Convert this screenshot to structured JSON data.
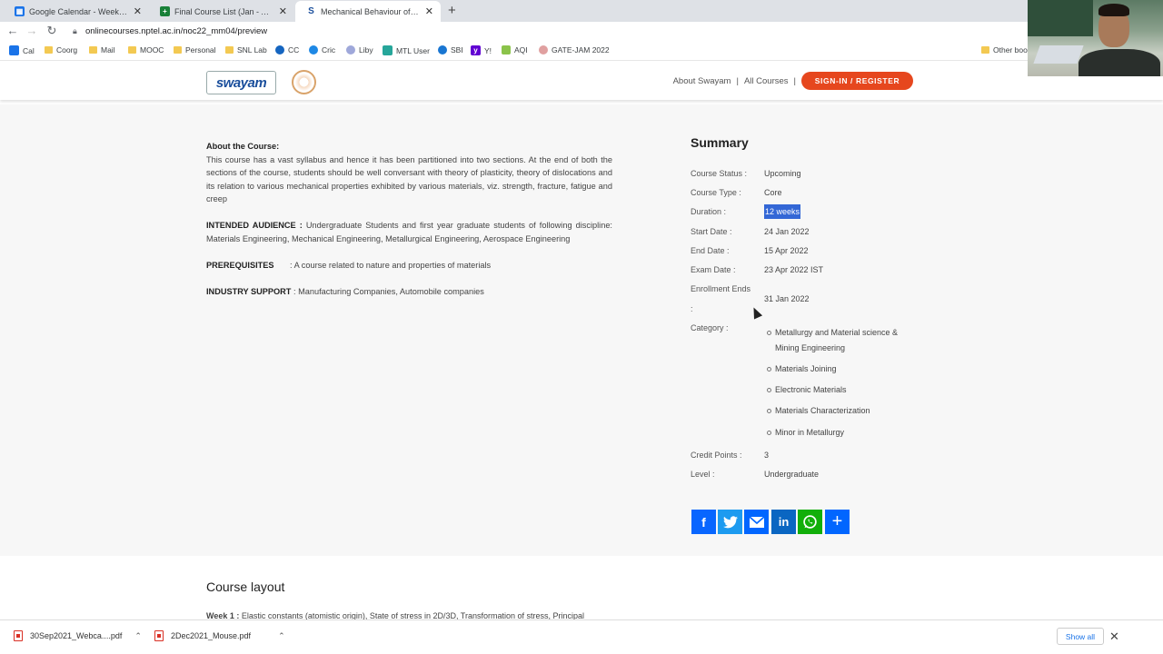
{
  "browser": {
    "tabs": [
      {
        "title": "Google Calendar - Week of Dece...",
        "favicon": "calendar-icon",
        "color": "#1a73e8"
      },
      {
        "title": "Final Course List (Jan - April 2022...",
        "favicon": "sheets-icon",
        "color": "#188038"
      },
      {
        "title": "Mechanical Behaviour of Materia...",
        "favicon": "swayam-icon",
        "color": "#1b4f9c"
      }
    ],
    "new_tab": "+",
    "url": "onlinecourses.nptel.ac.in/noc22_mm04/preview",
    "bookmarks": [
      "Cal",
      "Coorg",
      "Mail",
      "MOOC",
      "Personal",
      "SNL Lab",
      "CC",
      "Cric",
      "Liby",
      "MTL User",
      "SBI",
      "Y!",
      "AQI",
      "GATE-JAM 2022"
    ],
    "other_bookmarks": "Other boo"
  },
  "header": {
    "logo": "swayam",
    "links": [
      "About Swayam",
      "|",
      "All Courses",
      "|"
    ],
    "signin": "SIGN-IN / REGISTER"
  },
  "about": {
    "heading": "About the Course:",
    "text": "This course has a vast syllabus and hence it has been partitioned into two sections. At the end of both the sections of the course, students should be well conversant with theory of plasticity, theory of dislocations and its relation to various mechanical properties exhibited by various materials, viz. strength, fracture, fatigue and creep",
    "audience_label": "INTENDED AUDIENCE :",
    "audience": "Undergraduate Students and first year graduate students of following discipline: Materials Engineering, Mechanical Engineering, Metallurgical Engineering, Aerospace Engineering",
    "prereq_label": "PREREQUISITES",
    "prereq": ": A course related to nature and properties of materials",
    "industry_label": "INDUSTRY SUPPORT",
    "industry": ": Manufacturing Companies, Automobile companies"
  },
  "summary": {
    "title": "Summary",
    "status_label": "Course Status :",
    "status": "Upcoming",
    "type_label": "Course Type :",
    "type": "Core",
    "duration_label": "Duration :",
    "duration": "12 weeks",
    "start_label": "Start Date :",
    "start": "24 Jan 2022",
    "end_label": "End Date :",
    "end": "15 Apr 2022",
    "exam_label": "Exam Date :",
    "exam": "23 Apr 2022 IST",
    "enroll_label": "Enrollment Ends",
    "enroll_colon": ":",
    "enroll": "31 Jan 2022",
    "category_label": "Category :",
    "categories": [
      "Metallurgy and Material science & Mining Engineering",
      "Materials Joining",
      "Electronic Materials",
      "Materials Characterization",
      "Minor in Metallurgy"
    ],
    "credit_label": "Credit Points :",
    "credit": "3",
    "level_label": "Level :",
    "level": "Undergraduate"
  },
  "share": {
    "icons": [
      "facebook-icon",
      "twitter-icon",
      "email-icon",
      "linkedin-icon",
      "whatsapp-icon",
      "share-icon"
    ],
    "colors": [
      "#0866ff",
      "#1d9bf0",
      "#0166ff",
      "#0a66c2",
      "#12af0a",
      "#0166ff"
    ]
  },
  "course_layout": {
    "title": "Course layout",
    "week1_label": "Week 1 :",
    "week1": "Elastic constants (atomistic origin), State of stress in 2D/3D, Transformation of stress, Principal"
  },
  "downloads": {
    "files": [
      "30Sep2021_Webca....pdf",
      "2Dec2021_Mouse.pdf"
    ],
    "show_all": "Show all"
  }
}
